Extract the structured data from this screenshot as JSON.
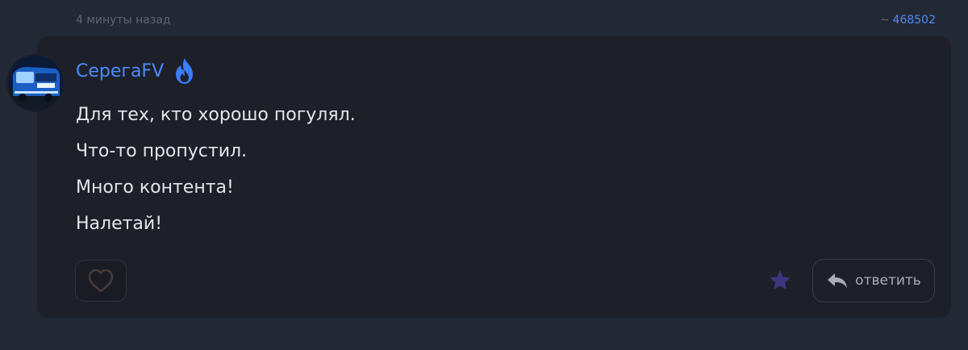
{
  "meta": {
    "timestamp": "4 минуты назад",
    "post_ref_prefix": "~",
    "post_ref": "468502"
  },
  "author": {
    "name": "СерегаFV",
    "badge_icon": "fire-icon"
  },
  "body": {
    "lines": [
      "Для тех, кто хорошо погулял.",
      "Что-то пропустил.",
      "Много контента!",
      "Налетай!"
    ]
  },
  "actions": {
    "like_icon": "heart-icon",
    "star_icon": "star-icon",
    "reply_label": "ответить",
    "reply_icon": "reply-arrow-icon"
  },
  "colors": {
    "accent": "#4a8cff",
    "star": "#3f3580",
    "background": "#222834",
    "card": "#1d2029"
  }
}
